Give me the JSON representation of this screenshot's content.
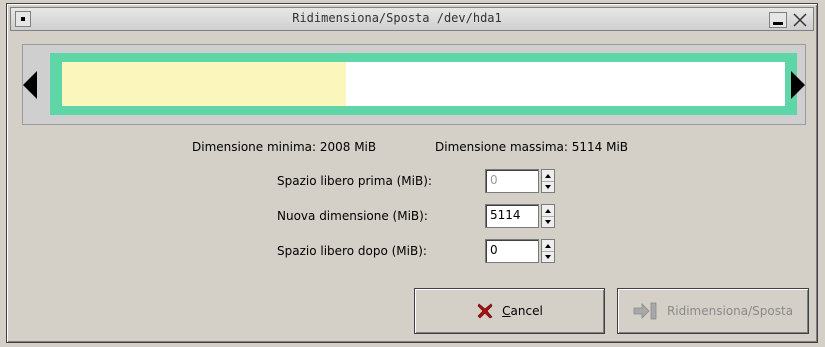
{
  "window": {
    "title": "Ridimensiona/Sposta /dev/hda1"
  },
  "partition": {
    "used_fraction": 0.393,
    "colors": {
      "border": "#5fd6a8",
      "used": "#fbf6bb",
      "free": "#ffffff"
    }
  },
  "info": {
    "min_size": "Dimensione minima: 2008 MiB",
    "max_size": "Dimensione massima: 5114 MiB"
  },
  "form": {
    "free_before": {
      "label": "Spazio libero prima (MiB):",
      "value": "0"
    },
    "new_size": {
      "label": "Nuova dimensione (MiB):",
      "value": "5114"
    },
    "free_after": {
      "label": "Spazio libero dopo (MiB):",
      "value": "0"
    }
  },
  "buttons": {
    "cancel": {
      "label_mnemonic": "C",
      "label_rest": "ancel",
      "icon": "x-icon"
    },
    "resize": {
      "label": "Ridimensiona/Sposta",
      "icon": "move-resize-icon",
      "enabled": false
    }
  }
}
